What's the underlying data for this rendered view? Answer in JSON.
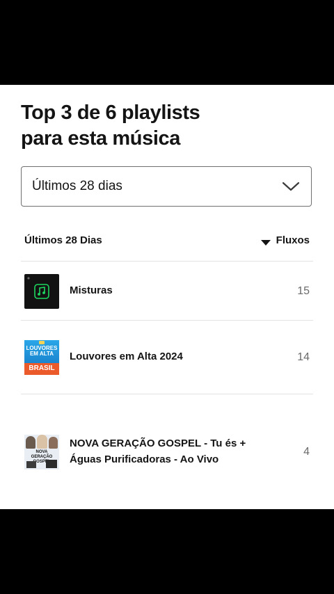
{
  "heading": {
    "line1": "Top 3 de 6 playlists",
    "line2": "para esta música"
  },
  "period_select": {
    "value": "Últimos 28 dias",
    "icon": "chevron-down-icon"
  },
  "table": {
    "period_header": "Últimos 28 Dias",
    "metric_header": "Fluxos",
    "sort_icon": "caret-down-icon",
    "rows": [
      {
        "title": "Misturas",
        "streams": "15",
        "cover_icon": "music-note-icon"
      },
      {
        "title": "Louvores em Alta 2024",
        "streams": "14",
        "cover_text_top": "LOUVORES EM ALTA",
        "cover_text_bottom": "BRASIL"
      },
      {
        "title": "NOVA GERAÇÃO GOSPEL - Tu és + Águas Purificadoras - Ao Vivo",
        "streams": "4",
        "cover_text": "NOVA GERAÇÃO GOSPEL"
      }
    ]
  },
  "colors": {
    "background": "#000000",
    "card": "#ffffff",
    "text": "#141414",
    "muted": "#6a6a6a",
    "accent_green": "#1ed760"
  }
}
